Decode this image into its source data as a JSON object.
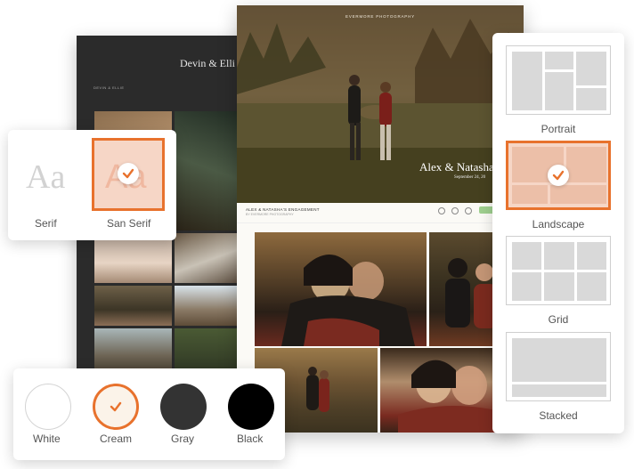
{
  "dark_gallery": {
    "title": "Devin & Elli",
    "subtitle": "DEVIN & ELLIE"
  },
  "light_gallery": {
    "brand": "EVERMORE PHOTOGRAPHY",
    "hero_name": "Alex & Natasha",
    "hero_date": "September 24, 20",
    "header_title": "ALEX & NATASHA'S ENGAGEMENT",
    "header_sub": "BY EVERMORE PHOTOGRAPHY"
  },
  "font_options": {
    "sample": "Aa",
    "options": [
      {
        "label": "Serif",
        "selected": false
      },
      {
        "label": "San Serif",
        "selected": true
      }
    ]
  },
  "color_options": [
    {
      "label": "White",
      "color": "#ffffff",
      "selected": false
    },
    {
      "label": "Cream",
      "color": "#fbf3e9",
      "selected": true
    },
    {
      "label": "Gray",
      "color": "#333333",
      "selected": false
    },
    {
      "label": "Black",
      "color": "#000000",
      "selected": false
    }
  ],
  "layout_options": [
    {
      "label": "Portrait",
      "selected": false
    },
    {
      "label": "Landscape",
      "selected": true
    },
    {
      "label": "Grid",
      "selected": false
    },
    {
      "label": "Stacked",
      "selected": false
    }
  ],
  "accent_color": "#e8722d"
}
